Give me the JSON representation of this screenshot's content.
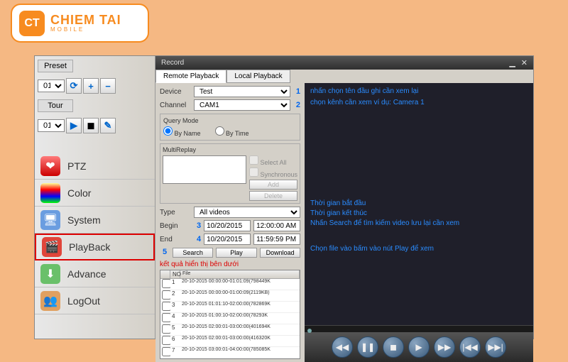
{
  "logo": {
    "badge": "CT",
    "name": "CHIEM TAI",
    "sub": "MOBILE"
  },
  "sidebar": {
    "preset_label": "Preset",
    "preset_value": "01",
    "tour_label": "Tour",
    "tour_value": "01",
    "menu": [
      {
        "label": "PTZ"
      },
      {
        "label": "Color"
      },
      {
        "label": "System"
      },
      {
        "label": "PlayBack"
      },
      {
        "label": "Advance"
      },
      {
        "label": "LogOut"
      }
    ]
  },
  "record": {
    "title": "Record",
    "tabs": {
      "remote": "Remote Playback",
      "local": "Local Playback"
    },
    "device_label": "Device",
    "device_value": "Test",
    "channel_label": "Channel",
    "channel_value": "CAM1",
    "query_title": "Query Mode",
    "by_name": "By Name",
    "by_time": "By Time",
    "multireplay": "MultiReplay",
    "select_all": "Select All",
    "synchronous": "Synchronous",
    "add": "Add",
    "delete": "Delete",
    "type_label": "Type",
    "type_value": "All videos",
    "begin_label": "Begin",
    "begin_date": "10/20/2015",
    "begin_time": "12:00:00 AM",
    "end_label": "End",
    "end_date": "10/20/2015",
    "end_time": "11:59:59 PM",
    "search": "Search",
    "play": "Play",
    "download": "Download",
    "result_caption": "kết quả hiển thị bên dưới",
    "nums": {
      "n1": "1",
      "n2": "2",
      "n3": "3",
      "n4": "4",
      "n5": "5"
    },
    "cols": {
      "no": "NO",
      "file": "File"
    },
    "rows": [
      {
        "n": "1",
        "f": "20-10-2015 00:00:00-01:01:09(798449K"
      },
      {
        "n": "2",
        "f": "20-10-2015 00:00:00-01:00:09(2119KB)"
      },
      {
        "n": "3",
        "f": "20-10-2015 01:01:10-02:00:00(782869K"
      },
      {
        "n": "4",
        "f": "20-10-2015 01:00:10-02:00:00(78293K"
      },
      {
        "n": "5",
        "f": "20-10-2015 02:00:01-03:00:00(401694K"
      },
      {
        "n": "6",
        "f": "20-10-2015 02:00:01-03:00:00(416320K"
      },
      {
        "n": "7",
        "f": "20-10-2015 03:00:01-04:00:00(785085K"
      }
    ]
  },
  "annotations": {
    "a1": "nhấn chọn tên đầu ghi cần xem lại",
    "a2": "chọn kênh cần xem ví dụ: Camera 1",
    "a3": "Thời gian bắt đầu",
    "a4": "Thời gian kết thúc",
    "a5": "Nhấn Search để tìm kiếm video lưu lại cần xem",
    "a6": "Chọn file vào bấm vào nút Play để xem"
  }
}
